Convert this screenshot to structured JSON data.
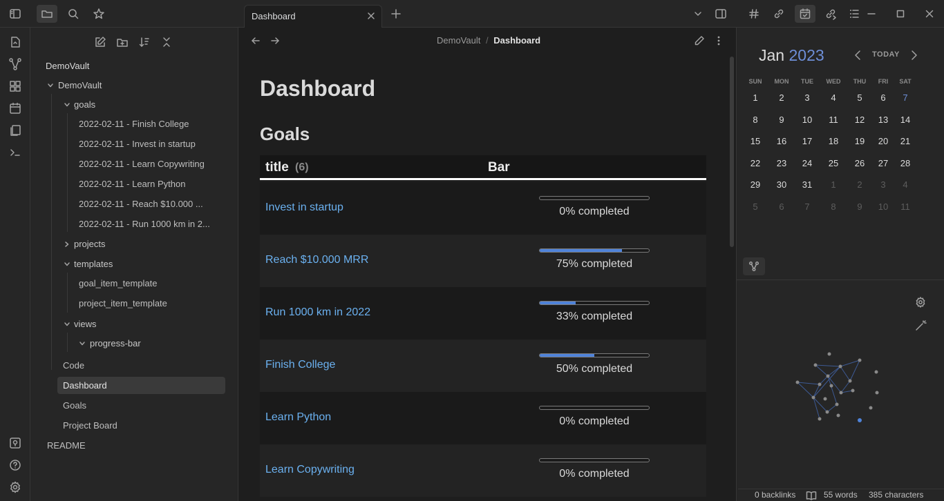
{
  "tab": {
    "title": "Dashboard"
  },
  "breadcrumb": {
    "vault": "DemoVault",
    "separator": "/",
    "current": "Dashboard"
  },
  "explorer": {
    "vault_name": "DemoVault",
    "root_folder": "DemoVault",
    "goals_folder": "goals",
    "goals": [
      "2022-02-11 - Finish College",
      "2022-02-11 - Invest in startup",
      "2022-02-11 - Learn Copywriting",
      "2022-02-11 - Learn Python",
      "2022-02-11 - Reach $10.000 ...",
      "2022-02-11 - Run 1000 km in 2..."
    ],
    "projects_folder": "projects",
    "templates_folder": "templates",
    "templates": [
      "goal_item_template",
      "project_item_template"
    ],
    "views_folder": "views",
    "progress_folder": "progress-bar",
    "files": [
      "Code",
      "Dashboard",
      "Goals",
      "Project Board"
    ],
    "readme": "README"
  },
  "note": {
    "title": "Dashboard",
    "section": "Goals",
    "table": {
      "col_title": "title",
      "count": "(6)",
      "col_bar": "Bar",
      "rows": [
        {
          "title": "Invest in startup",
          "progress": 0,
          "label": "0% completed"
        },
        {
          "title": "Reach $10.000 MRR",
          "progress": 75,
          "label": "75% completed"
        },
        {
          "title": "Run 1000 km in 2022",
          "progress": 33,
          "label": "33% completed"
        },
        {
          "title": "Finish College",
          "progress": 50,
          "label": "50% completed"
        },
        {
          "title": "Learn Python",
          "progress": 0,
          "label": "0% completed"
        },
        {
          "title": "Learn Copywriting",
          "progress": 0,
          "label": "0% completed"
        }
      ]
    }
  },
  "calendar": {
    "month": "Jan",
    "year": "2023",
    "today_label": "TODAY",
    "weekdays": [
      "SUN",
      "MON",
      "TUE",
      "WED",
      "THU",
      "FRI",
      "SAT"
    ],
    "weeks": [
      [
        "1",
        "2",
        "3",
        "4",
        "5",
        "6",
        "7"
      ],
      [
        "8",
        "9",
        "10",
        "11",
        "12",
        "13",
        "14"
      ],
      [
        "15",
        "16",
        "17",
        "18",
        "19",
        "20",
        "21"
      ],
      [
        "22",
        "23",
        "24",
        "25",
        "26",
        "27",
        "28"
      ],
      [
        "29",
        "30",
        "31",
        "1",
        "2",
        "3",
        "4"
      ],
      [
        "5",
        "6",
        "7",
        "8",
        "9",
        "10",
        "11"
      ]
    ]
  },
  "status": {
    "backlinks": "0 backlinks",
    "words": "55 words",
    "characters": "385 characters"
  },
  "colors": {
    "accent": "#4f83d9",
    "link": "#6bb1f0"
  }
}
